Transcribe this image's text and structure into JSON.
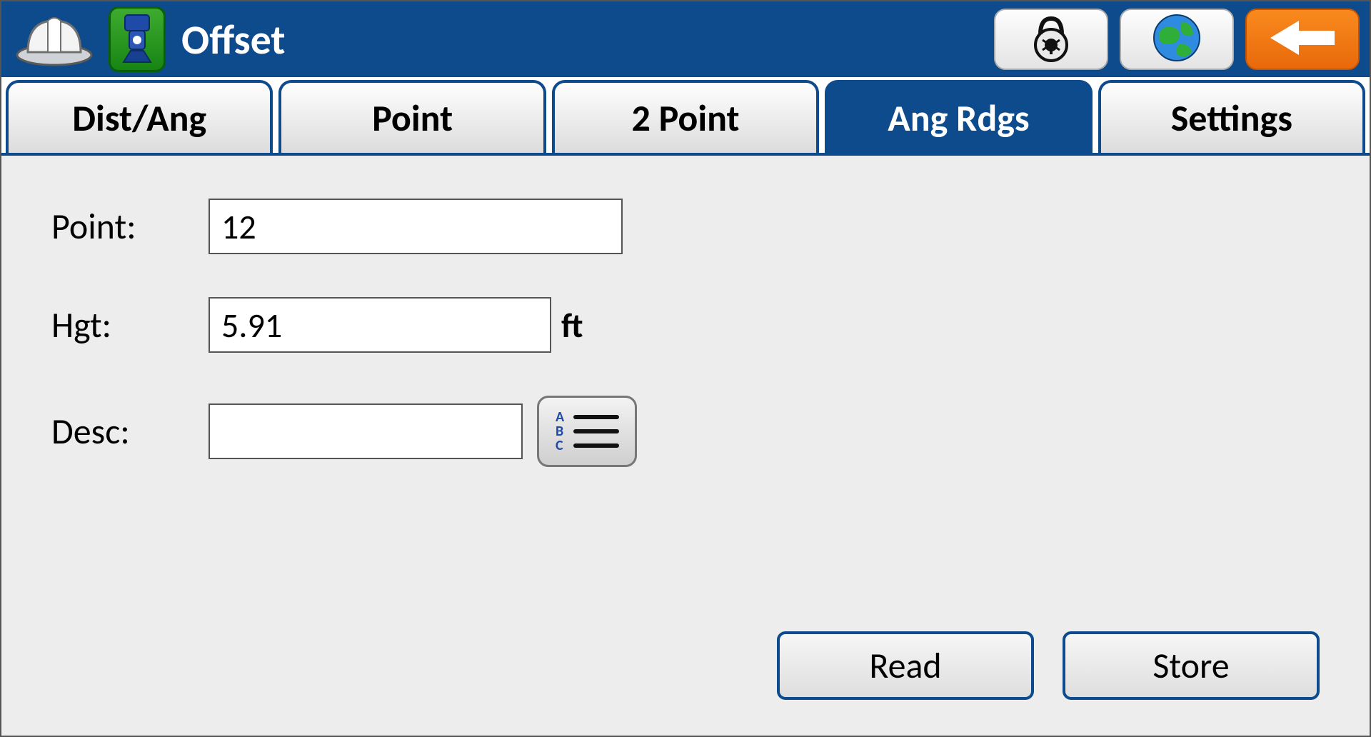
{
  "header": {
    "title": "Offset"
  },
  "tabs": {
    "dist_ang": "Dist/Ang",
    "point": "Point",
    "two_point": "2 Point",
    "ang_rdgs": "Ang Rdgs",
    "settings": "Settings"
  },
  "form": {
    "point_label": "Point:",
    "point_value": "12",
    "hgt_label": "Hgt:",
    "hgt_value": "5.91",
    "hgt_unit": "ft",
    "desc_label": "Desc:",
    "desc_value": ""
  },
  "buttons": {
    "read": "Read",
    "store": "Store"
  },
  "icons": {
    "list_letters": "A B C"
  }
}
